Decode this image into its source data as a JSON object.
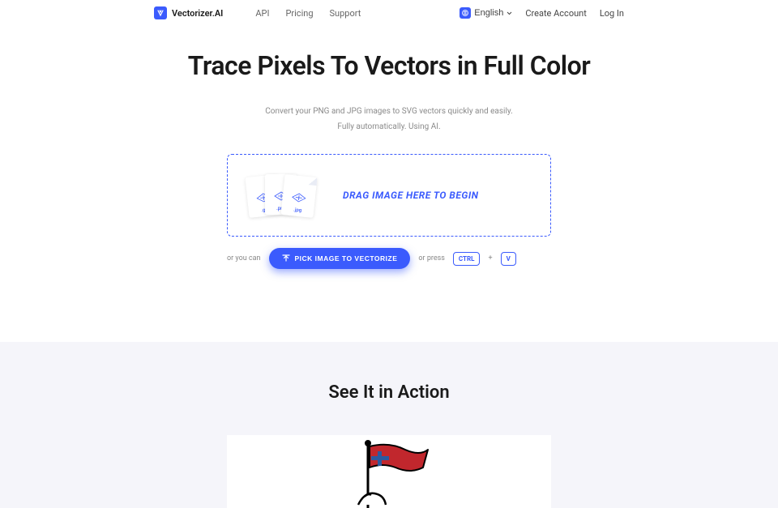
{
  "header": {
    "brand": "Vectorizer.AI",
    "nav": {
      "api": "API",
      "pricing": "Pricing",
      "support": "Support"
    },
    "lang": "English",
    "create": "Create Account",
    "login": "Log In"
  },
  "hero": {
    "title": "Trace Pixels To Vectors in Full Color",
    "sub1": "Convert your PNG and JPG images to SVG vectors quickly and easily.",
    "sub2": "Fully automatically. Using AI."
  },
  "drop": {
    "label": "DRAG IMAGE HERE TO BEGIN",
    "ext1": ".gif",
    "ext2": ".png",
    "ext3": ".jpg"
  },
  "actions": {
    "or1": "or you can",
    "pick": "PICK IMAGE TO VECTORIZE",
    "or2": "or press",
    "k1": "CTRL",
    "plus": "+",
    "k2": "V"
  },
  "section2": {
    "title": "See It in Action"
  }
}
